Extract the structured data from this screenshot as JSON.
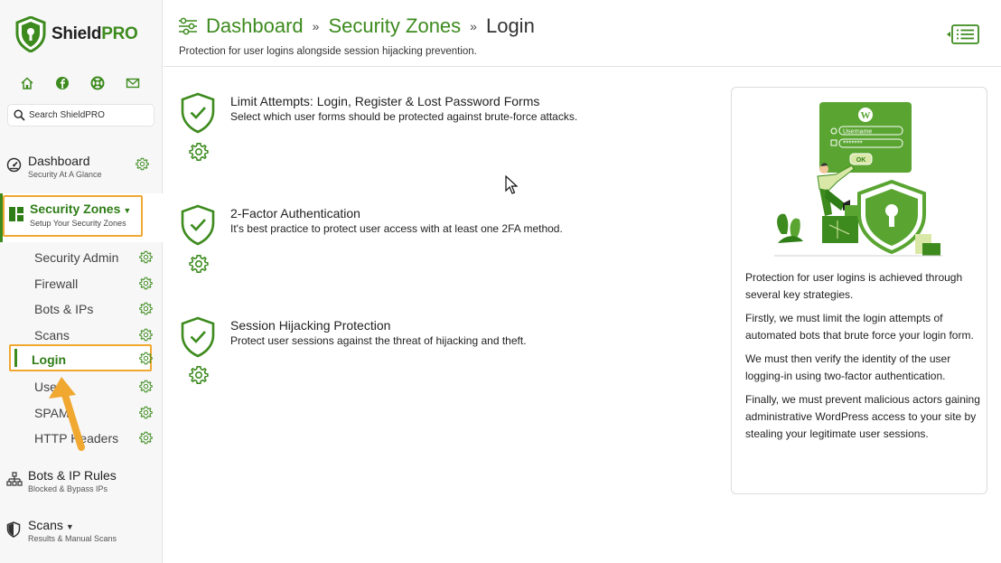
{
  "app": {
    "name_main": "Shield",
    "name_accent": "PRO"
  },
  "sidebar": {
    "quick_icons": [
      "home-icon",
      "facebook-icon",
      "help-icon",
      "mail-icon"
    ],
    "search_placeholder": "Search ShieldPRO",
    "dashboard": {
      "title": "Dashboard",
      "subtitle": "Security At A Glance"
    },
    "security_zones": {
      "title": "Security Zones",
      "subtitle": "Setup Your Security Zones",
      "items": [
        {
          "label": "Security Admin"
        },
        {
          "label": "Firewall"
        },
        {
          "label": "Bots & IPs"
        },
        {
          "label": "Scans"
        },
        {
          "label": "Login"
        },
        {
          "label": "Users"
        },
        {
          "label": "SPAM"
        },
        {
          "label": "HTTP Headers"
        }
      ]
    },
    "bots_rules": {
      "title": "Bots & IP Rules",
      "subtitle": "Blocked & Bypass IPs"
    },
    "scans": {
      "title": "Scans",
      "subtitle": "Results & Manual Scans"
    }
  },
  "header": {
    "breadcrumb": [
      "Dashboard",
      "Security Zones",
      "Login"
    ],
    "separator": "»",
    "description": "Protection for user logins alongside session hijacking prevention."
  },
  "items": [
    {
      "title": "Limit Attempts: Login, Register & Lost Password Forms",
      "desc": "Select which user forms should be protected against brute-force attacks."
    },
    {
      "title": "2-Factor Authentication",
      "desc": "It's best practice to protect user access with at least one 2FA method."
    },
    {
      "title": "Session Hijacking Protection",
      "desc": "Protect user sessions against the threat of hijacking and theft."
    }
  ],
  "info": {
    "illustration": {
      "username": "Username",
      "password": "*******",
      "ok": "OK"
    },
    "paragraphs": [
      "Protection for user logins is achieved through several key strategies.",
      "Firstly, we must limit the login attempts of automated bots that brute force your login form.",
      "We must then verify the identity of the user logging-in using two-factor authentication.",
      "Finally, we must prevent malicious actors gaining administrative WordPress access to your site by stealing your legitimate user sessions."
    ]
  },
  "colors": {
    "accent": "#3d8b1e",
    "highlight": "#f0a830"
  }
}
